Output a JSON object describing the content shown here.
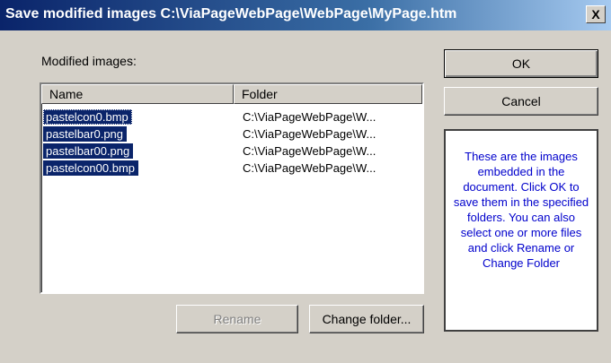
{
  "window": {
    "title": "Save modified images C:\\ViaPageWebPage\\WebPage\\MyPage.htm",
    "close_label": "X"
  },
  "list": {
    "label": "Modified images:",
    "columns": [
      "Name",
      "Folder"
    ],
    "rows": [
      {
        "name": "pastelcon0.bmp",
        "folder": "C:\\ViaPageWebPage\\W..."
      },
      {
        "name": "pastelbar0.png",
        "folder": "C:\\ViaPageWebPage\\W..."
      },
      {
        "name": "pastelbar00.png",
        "folder": "C:\\ViaPageWebPage\\W..."
      },
      {
        "name": "pastelcon00.bmp",
        "folder": "C:\\ViaPageWebPage\\W..."
      }
    ]
  },
  "buttons": {
    "ok": "OK",
    "cancel": "Cancel",
    "rename": "Rename",
    "change_folder": "Change folder..."
  },
  "info": {
    "text": "These are the images embedded in the document. Click OK to save them in the specified folders. You can also select one or more files and click Rename or Change Folder"
  },
  "colors": {
    "selection": "#0a246a",
    "info_text": "#0000cc",
    "dialog_face": "#d4d0c8"
  }
}
